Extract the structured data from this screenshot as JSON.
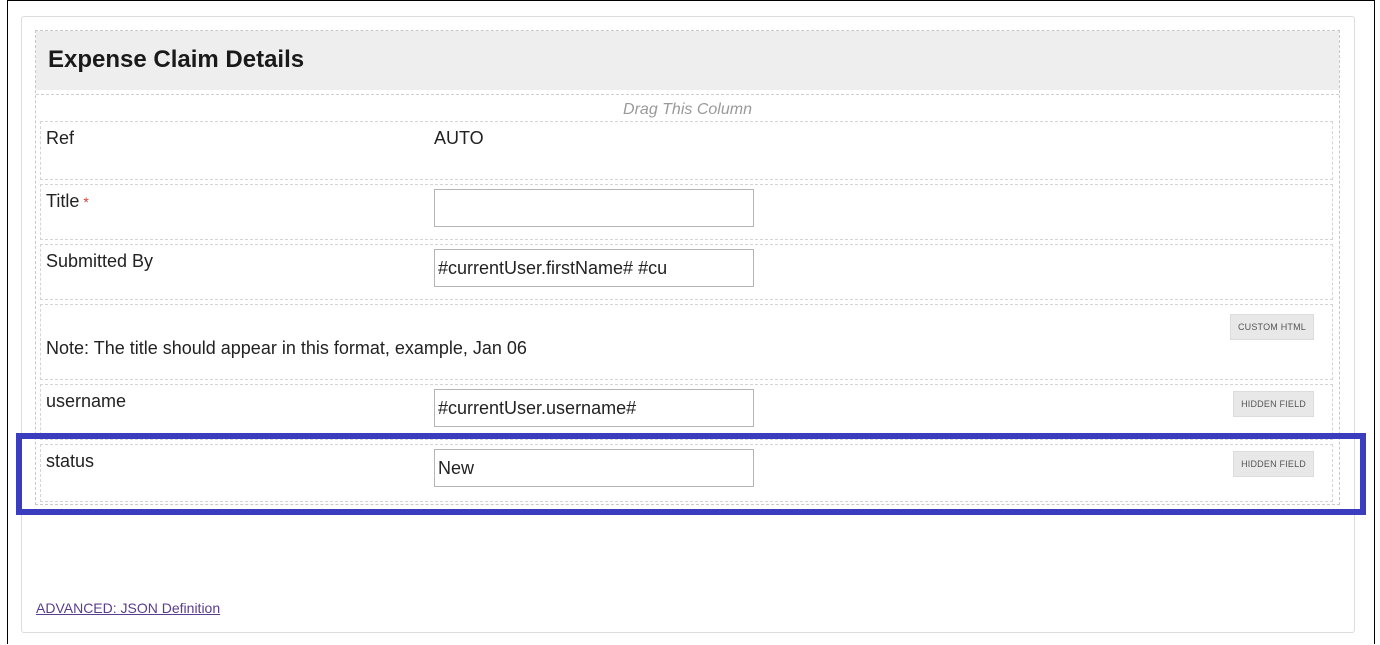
{
  "section": {
    "title": "Expense Claim Details",
    "drag_column_label": "Drag This Column"
  },
  "rows": [
    {
      "label": "Ref",
      "value": "AUTO"
    },
    {
      "label": "Title",
      "required_marker": "*",
      "input_value": ""
    },
    {
      "label": "Submitted By",
      "input_value": "#currentUser.firstName# #cu"
    },
    {
      "note": "Note: The title should appear in this format, example, Jan 06",
      "badge": "CUSTOM HTML"
    },
    {
      "label": "username",
      "input_value": "#currentUser.username#",
      "badge": "HIDDEN FIELD"
    },
    {
      "label": "status",
      "input_value": "New",
      "badge": "HIDDEN FIELD"
    }
  ],
  "footer": {
    "advanced_link": "ADVANCED: JSON Definition"
  },
  "colors": {
    "highlight": "#3b3dbf",
    "required": "#d43f3a",
    "link": "#5b3d8e",
    "header_bg": "#eeeeee"
  }
}
